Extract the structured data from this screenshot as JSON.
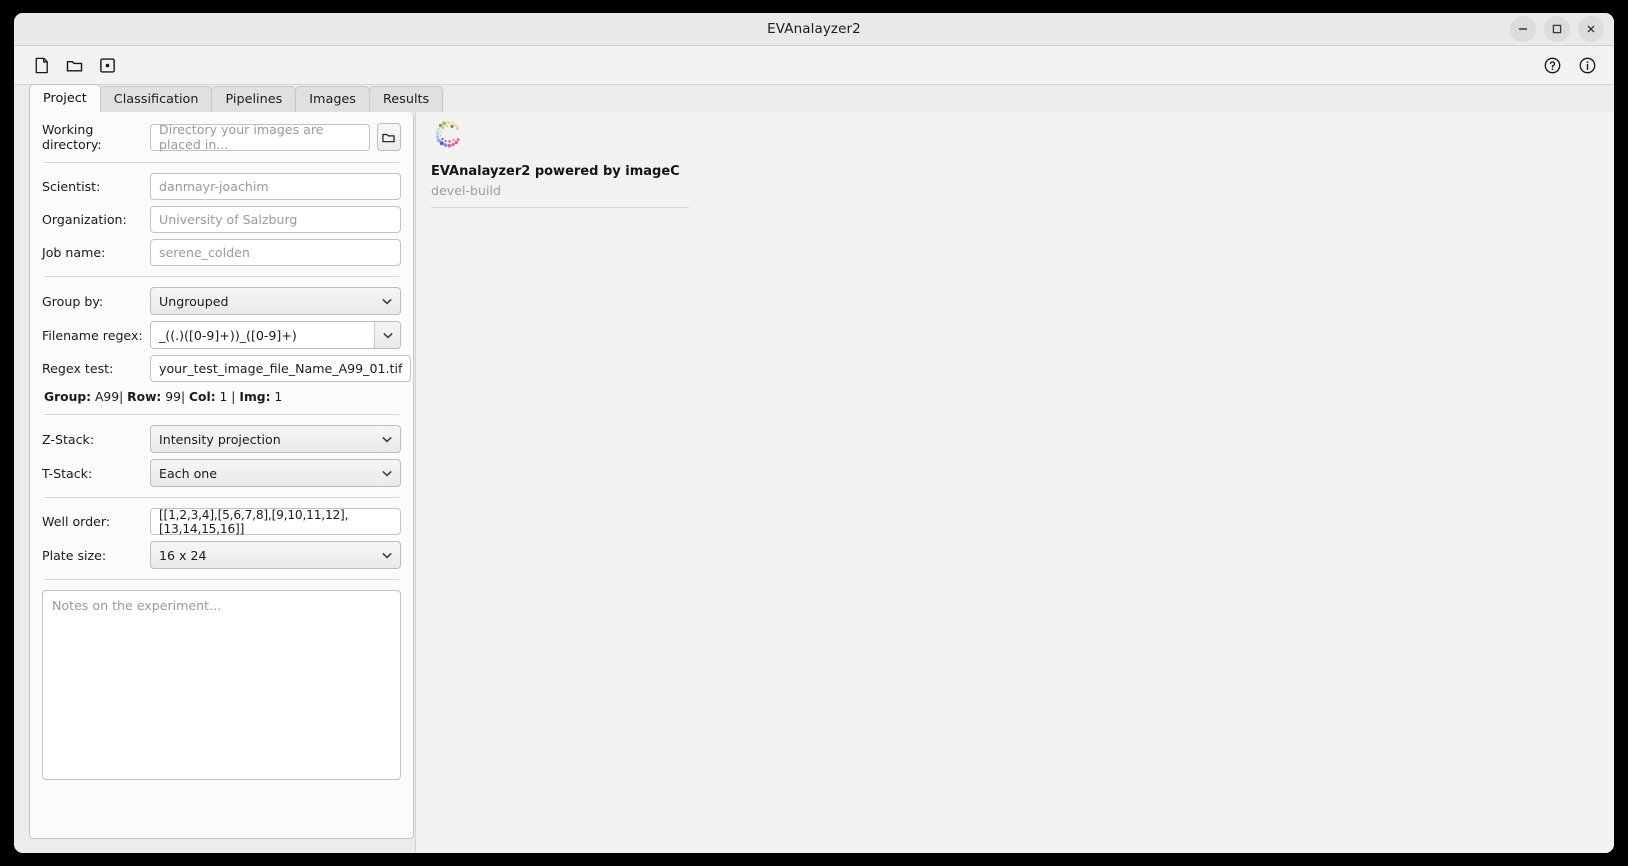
{
  "window": {
    "title": "EVAnalayzer2",
    "controls": [
      {
        "name": "minimize",
        "glyph": "minimize-icon"
      },
      {
        "name": "maximize",
        "glyph": "maximize-icon"
      },
      {
        "name": "close",
        "glyph": "close-icon"
      }
    ]
  },
  "toolbar": {
    "left_items": [
      {
        "name": "new-project",
        "icon": "new-file-icon"
      },
      {
        "name": "open-project",
        "icon": "folder-open-icon"
      },
      {
        "name": "save-project",
        "icon": "save-icon"
      }
    ],
    "right_items": [
      {
        "name": "help",
        "icon": "help-circle-icon"
      },
      {
        "name": "info",
        "icon": "info-circle-icon"
      }
    ]
  },
  "tabs": [
    {
      "label": "Project",
      "active": true
    },
    {
      "label": "Classification",
      "active": false
    },
    {
      "label": "Pipelines",
      "active": false
    },
    {
      "label": "Images",
      "active": false
    },
    {
      "label": "Results",
      "active": false
    }
  ],
  "form": {
    "working_directory": {
      "label": "Working directory:",
      "placeholder": "Directory your images are placed in...",
      "value": "",
      "browse_icon": "folder-icon"
    },
    "scientist": {
      "label": "Scientist:",
      "placeholder": "danmayr-joachim",
      "value": ""
    },
    "organization": {
      "label": "Organization:",
      "placeholder": "University of Salzburg",
      "value": ""
    },
    "job_name": {
      "label": "Job name:",
      "placeholder": "serene_colden",
      "value": ""
    },
    "group_by": {
      "label": "Group by:",
      "value": "Ungrouped"
    },
    "filename_regex": {
      "label": "Filename regex:",
      "value": "_((.)([0-9]+))_([0-9]+)"
    },
    "regex_test": {
      "label": "Regex test:",
      "value": "your_test_image_file_Name_A99_01.tif"
    },
    "group_info": {
      "group_label": "Group:",
      "group_value": "A99",
      "row_label": "Row:",
      "row_value": "99",
      "col_label": "Col:",
      "col_value": "1",
      "img_label": "Img:",
      "img_value": "1",
      "sep": "|"
    },
    "z_stack": {
      "label": "Z-Stack:",
      "value": "Intensity projection"
    },
    "t_stack": {
      "label": "T-Stack:",
      "value": "Each one"
    },
    "well_order": {
      "label": "Well order:",
      "value": "[[1,2,3,4],[5,6,7,8],[9,10,11,12],[13,14,15,16]]"
    },
    "plate_size": {
      "label": "Plate size:",
      "value": "16 x 24"
    },
    "notes": {
      "placeholder": "Notes on the experiment...",
      "value": ""
    }
  },
  "about": {
    "title": "EVAnalayzer2 powered by imageC",
    "subtitle": "devel-build",
    "logo_name": "imagec-dot-ring-logo"
  },
  "colors": {
    "window_bg": "#ececec",
    "panel_bg": "#fbfbfb",
    "toolbar_bg": "#f2f2f2",
    "border": "#c6c6c6",
    "text": "#1b1b1b",
    "placeholder": "#9a9a9a",
    "subtitle": "#9d9d9d"
  }
}
